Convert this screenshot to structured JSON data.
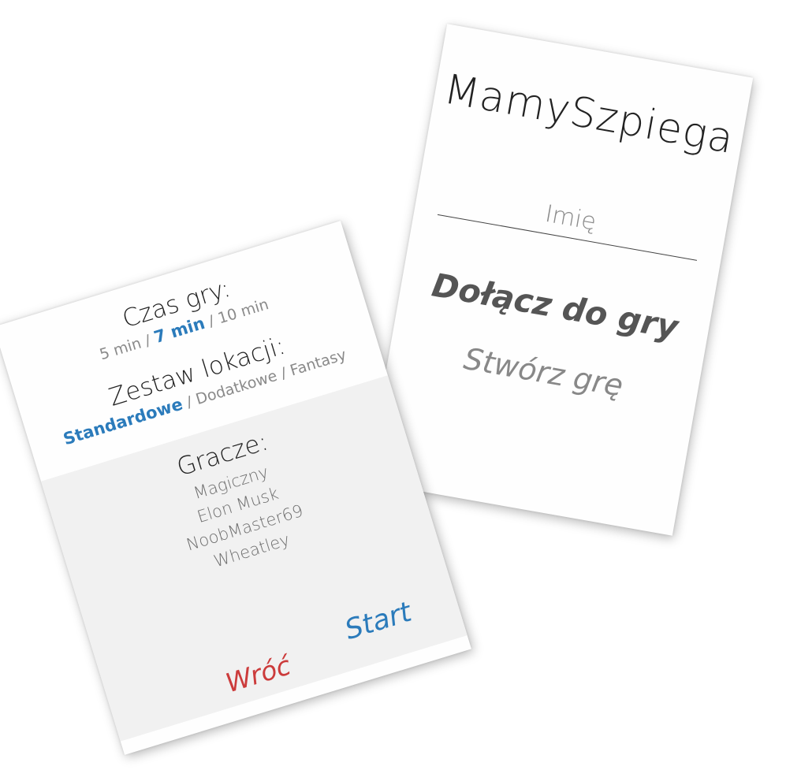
{
  "join_card": {
    "title": "MamySzpiega",
    "name_input": {
      "value": "",
      "placeholder": "Imię"
    },
    "join_label": "Dołącz do gry",
    "create_label": "Stwórz grę"
  },
  "lobby_card": {
    "game_time": {
      "heading": "Czas gry:",
      "options": [
        "5 min",
        "7 min",
        "10 min"
      ],
      "selected": "7 min",
      "separator": " / "
    },
    "location_set": {
      "heading": "Zestaw lokacji:",
      "options": [
        "Standardowe",
        "Dodatkowe",
        "Fantasy"
      ],
      "selected": "Standardowe",
      "separator": " / "
    },
    "players": {
      "heading": "Gracze:",
      "list": [
        "Magiczny",
        "Elon Musk",
        "NoobMaster69",
        "Wheatley"
      ]
    },
    "start_label": "Start",
    "back_label": "Wróć"
  },
  "colors": {
    "accent_blue": "#2b7bbb",
    "back_red": "#cc3b3b",
    "band_gray": "#f1f1f1"
  }
}
